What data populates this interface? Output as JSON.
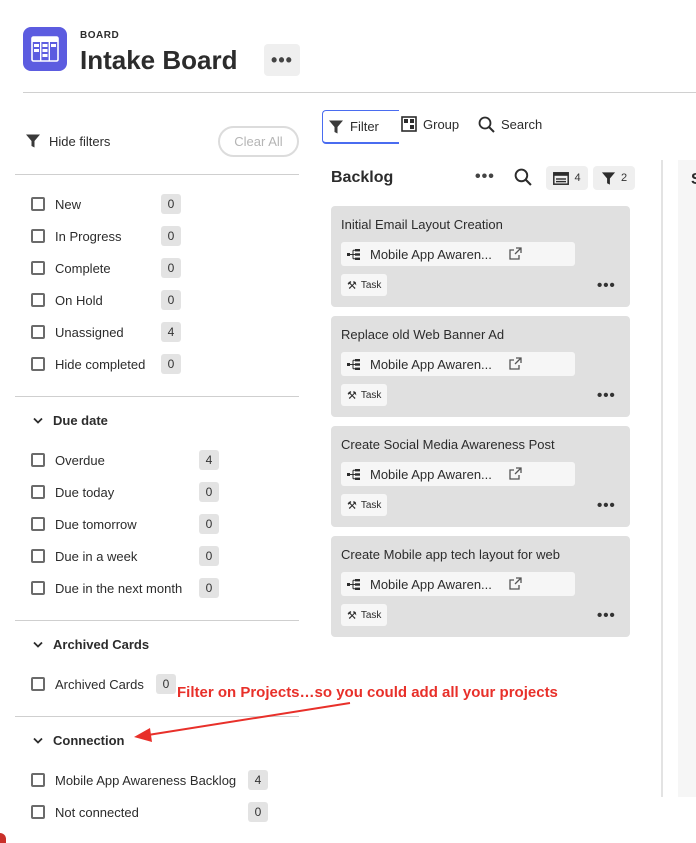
{
  "header": {
    "kicker": "BOARD",
    "title": "Intake Board",
    "more": "•••"
  },
  "sidebar": {
    "hide_filters": "Hide filters",
    "clear_all": "Clear All",
    "status": [
      {
        "label": "New",
        "count": "0"
      },
      {
        "label": "In Progress",
        "count": "0"
      },
      {
        "label": "Complete",
        "count": "0"
      },
      {
        "label": "On Hold",
        "count": "0"
      },
      {
        "label": "Unassigned",
        "count": "4"
      },
      {
        "label": "Hide completed",
        "count": "0"
      }
    ],
    "due_date": {
      "title": "Due date",
      "items": [
        {
          "label": "Overdue",
          "count": "4"
        },
        {
          "label": "Due today",
          "count": "0"
        },
        {
          "label": "Due tomorrow",
          "count": "0"
        },
        {
          "label": "Due in a week",
          "count": "0"
        },
        {
          "label": "Due in the next month",
          "count": "0"
        }
      ]
    },
    "archived": {
      "title": "Archived Cards",
      "items": [
        {
          "label": "Archived Cards",
          "count": "0"
        }
      ]
    },
    "connection": {
      "title": "Connection",
      "items": [
        {
          "label": "Mobile App Awareness Backlog",
          "count": "4"
        },
        {
          "label": "Not connected",
          "count": "0"
        }
      ]
    }
  },
  "toolbar": {
    "filter": "Filter",
    "group": "Group",
    "search": "Search"
  },
  "column": {
    "title": "Backlog",
    "more": "•••",
    "cards_count": "4",
    "filter_count": "2",
    "cards": [
      {
        "title": "Initial Email Layout Creation",
        "connection": "Mobile App Awaren...",
        "type": "Task"
      },
      {
        "title": "Replace old Web Banner Ad",
        "connection": "Mobile App Awaren...",
        "type": "Task"
      },
      {
        "title": "Create Social Media Awareness Post",
        "connection": "Mobile App Awaren...",
        "type": "Task"
      },
      {
        "title": "Create Mobile app tech layout for web",
        "connection": "Mobile App Awaren...",
        "type": "Task"
      }
    ]
  },
  "next_column": {
    "title_fragment": "S"
  },
  "annotation": {
    "text": "Filter on Projects…so you could add all your projects",
    "color": "#e8302a"
  },
  "colors": {
    "brand": "#5c5ce0",
    "focus": "#4a6cf0",
    "card_bg": "#e0e0e0"
  },
  "icons": {
    "board": "board-icon",
    "filter": "funnel-icon",
    "group": "group-icon",
    "search": "magnifier-icon",
    "chevron": "chevron-down-icon",
    "connection": "hierarchy-icon",
    "open": "open-in-new-icon",
    "task": "hammer-icon"
  }
}
